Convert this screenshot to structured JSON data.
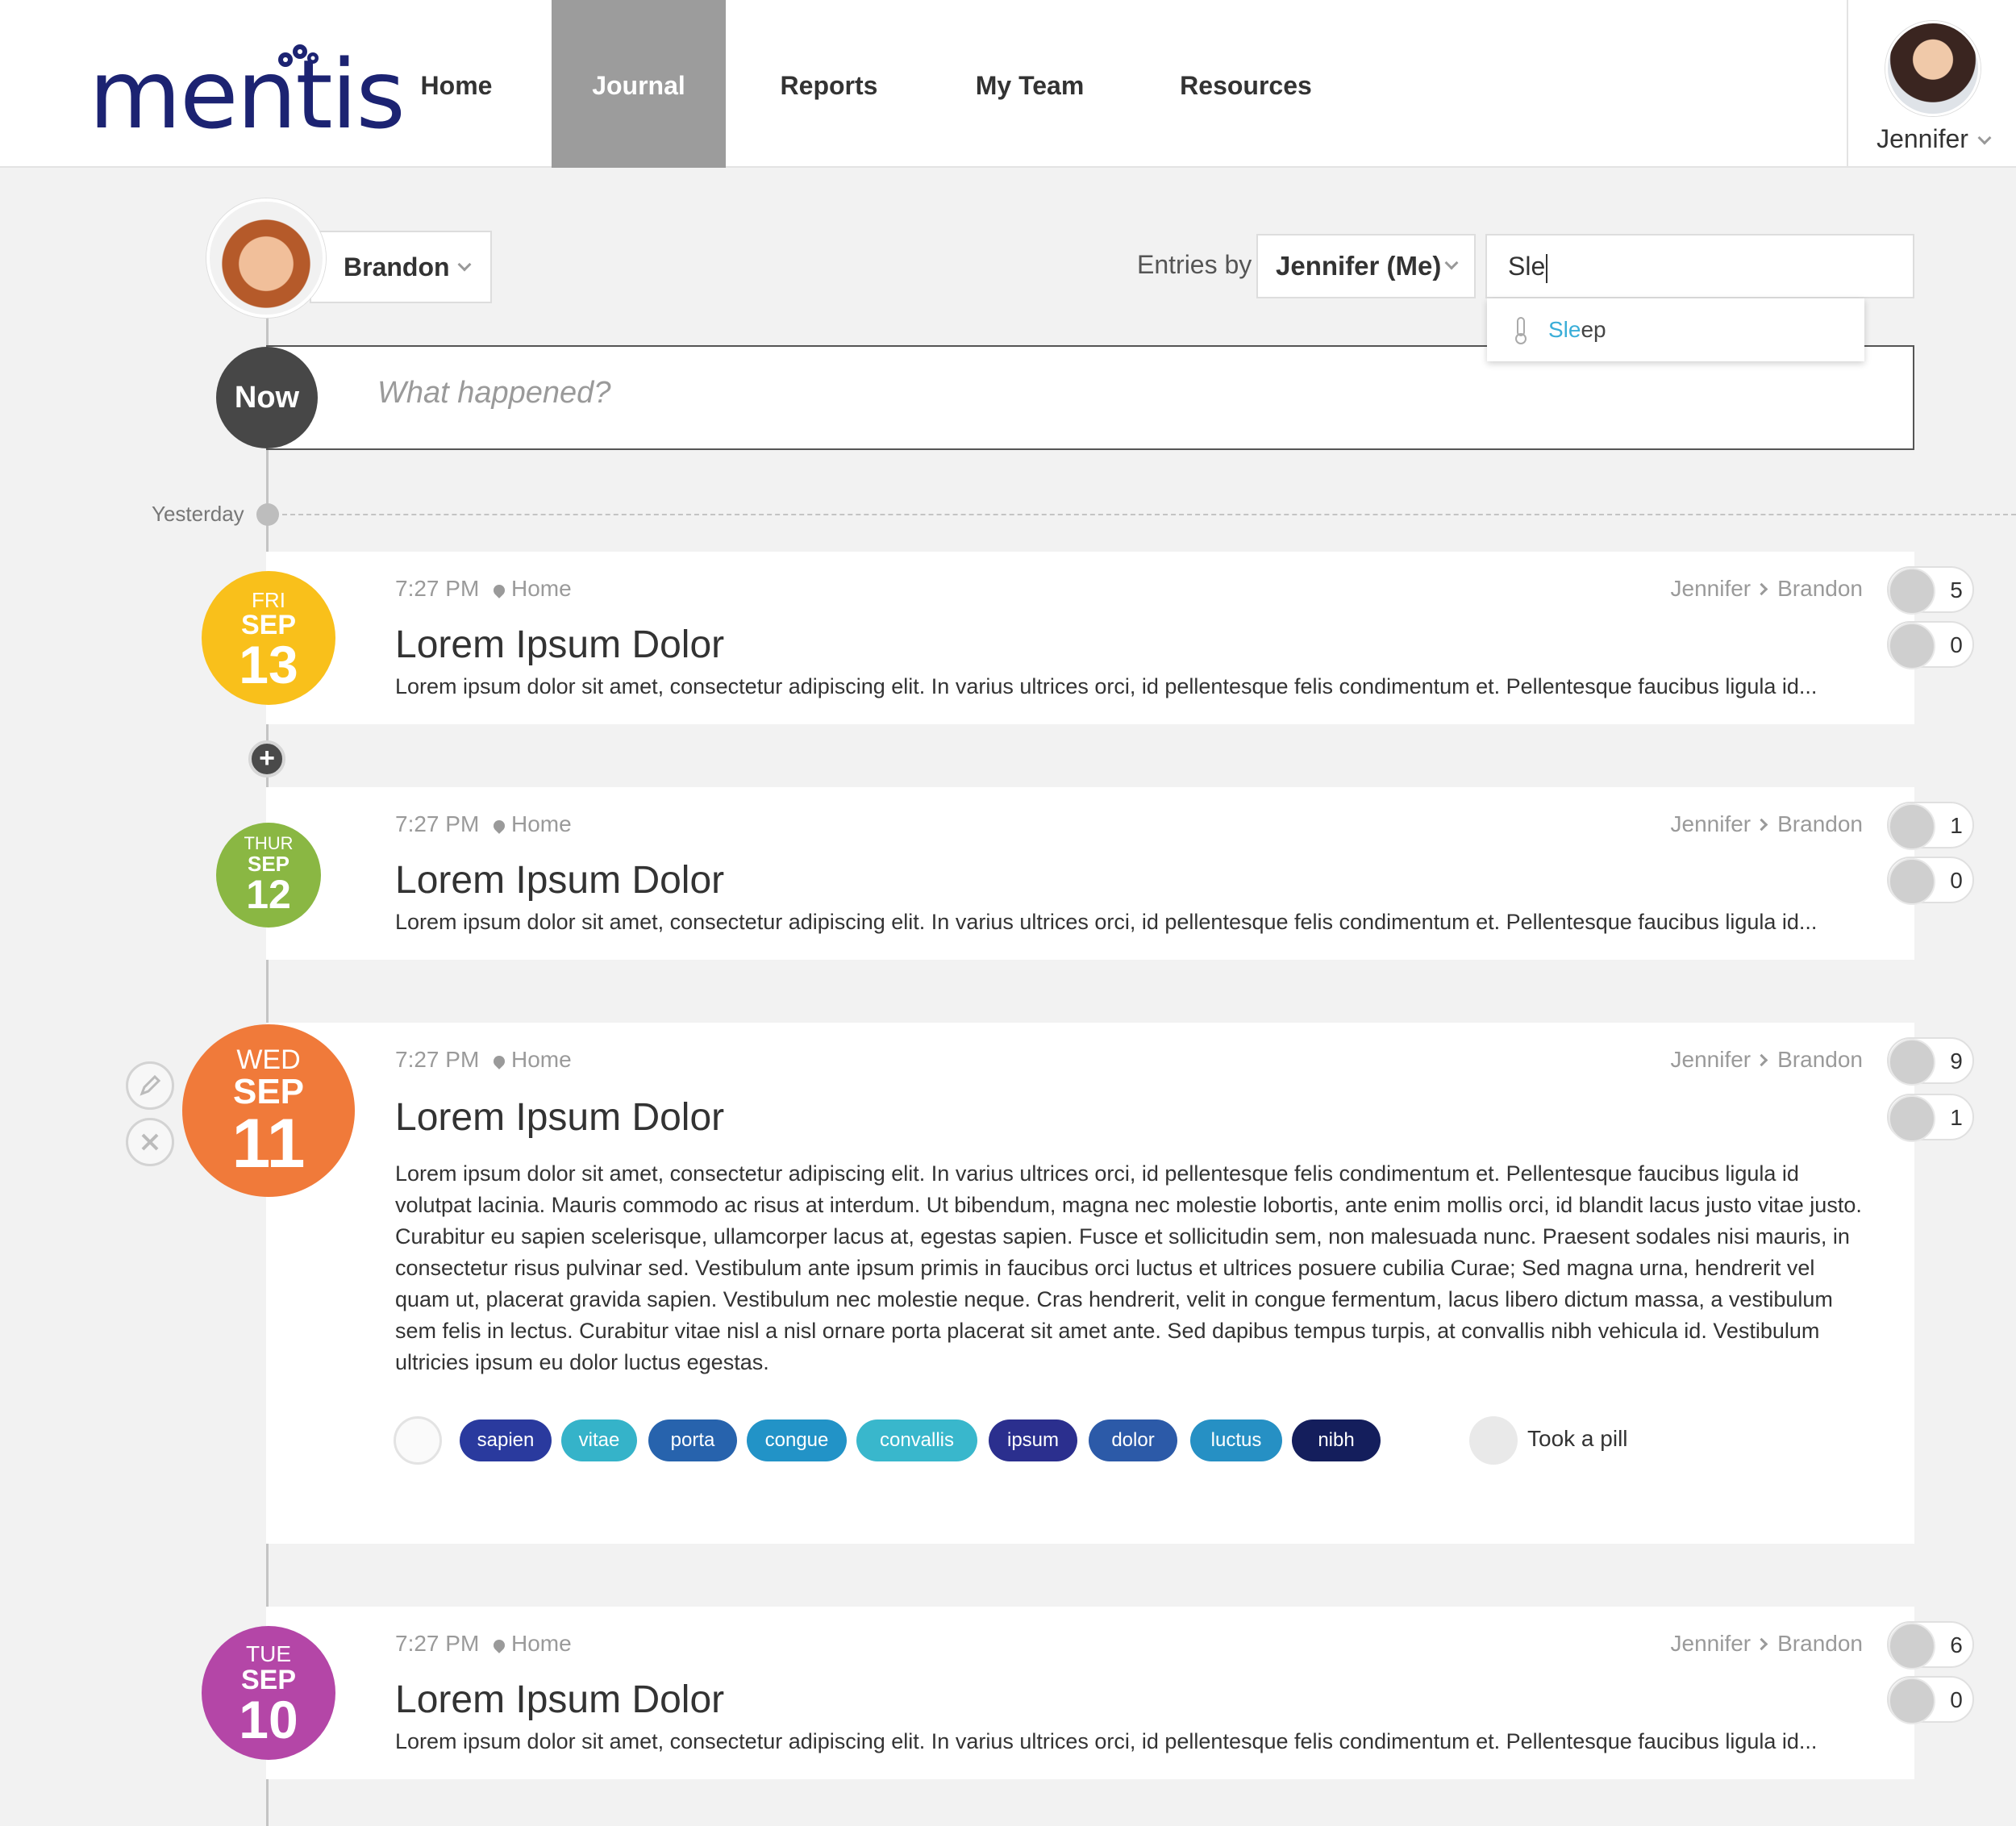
{
  "brand": {
    "logo_text": "mentis"
  },
  "nav": {
    "items": [
      {
        "label": "Home"
      },
      {
        "label": "Journal",
        "active": true
      },
      {
        "label": "Reports"
      },
      {
        "label": "My Team"
      },
      {
        "label": "Resources"
      }
    ]
  },
  "user": {
    "name": "Jennifer"
  },
  "child": {
    "name": "Brandon"
  },
  "filters": {
    "entries_by_label": "Entries by",
    "entries_by_value": "Jennifer (Me)",
    "search_value": "Sle",
    "suggestion": {
      "match": "Sle",
      "rest": "ep",
      "icon": "thermometer-icon"
    }
  },
  "composer": {
    "now_label": "Now",
    "placeholder": "What happened?"
  },
  "timeline": {
    "yesterday_label": "Yesterday"
  },
  "entries": [
    {
      "dow": "FRI",
      "month": "SEP",
      "day": "13",
      "color": "#f9c01b",
      "time": "7:27 PM",
      "location": "Home",
      "from": "Jennifer",
      "to": "Brandon",
      "title": "Lorem Ipsum Dolor",
      "text": "Lorem ipsum dolor sit amet, consectetur adipiscing elit. In varius ultrices orci, id pellentesque felis condimentum et. Pellentesque faucibus ligula id...",
      "count_a": "5",
      "count_b": "0"
    },
    {
      "dow": "THUR",
      "month": "SEP",
      "day": "12",
      "color": "#8ab743",
      "time": "7:27 PM",
      "location": "Home",
      "from": "Jennifer",
      "to": "Brandon",
      "title": "Lorem Ipsum Dolor",
      "text": "Lorem ipsum dolor sit amet, consectetur adipiscing elit. In varius ultrices orci, id pellentesque felis condimentum et. Pellentesque faucibus ligula id...",
      "count_a": "1",
      "count_b": "0"
    },
    {
      "dow": "WED",
      "month": "SEP",
      "day": "11",
      "color": "#f07a3a",
      "time": "7:27 PM",
      "location": "Home",
      "from": "Jennifer",
      "to": "Brandon",
      "title": "Lorem Ipsum Dolor",
      "text": "Lorem ipsum dolor sit amet, consectetur adipiscing elit. In varius ultrices orci, id pellentesque felis condimentum et. Pellentesque faucibus ligula id volutpat lacinia. Mauris commodo ac risus at interdum. Ut bibendum, magna nec molestie lobortis, ante enim mollis orci, id blandit lacus justo vitae justo. Curabitur eu sapien scelerisque, ullamcorper lacus at, egestas sapien. Fusce et sollicitudin sem, non malesuada nunc. Praesent sodales nisi mauris, in consectetur risus pulvinar sed. Vestibulum ante ipsum primis in faucibus orci luctus et ultrices posuere cubilia Curae; Sed magna urna, hendrerit vel quam ut, placerat gravida sapien. Vestibulum nec molestie neque. Cras hendrerit, velit in congue fermentum, lacus libero dictum massa, a vestibulum sem felis in lectus. Curabitur vitae nisl a nisl ornare porta placerat sit amet ante. Sed dapibus tempus turpis, at convallis nibh vehicula id. Vestibulum ultricies ipsum eu dolor luctus egestas.",
      "count_a": "9",
      "count_b": "1",
      "tags": [
        {
          "label": "sapien",
          "color": "#2a3a9e"
        },
        {
          "label": "vitae",
          "color": "#35b3c9"
        },
        {
          "label": "porta",
          "color": "#2763ad"
        },
        {
          "label": "congue",
          "color": "#2293c7"
        },
        {
          "label": "convallis",
          "color": "#39b7cc"
        },
        {
          "label": "ipsum",
          "color": "#2b2f8e"
        },
        {
          "label": "dolor",
          "color": "#2c5aa8"
        },
        {
          "label": "luctus",
          "color": "#2690c4"
        },
        {
          "label": "nibh",
          "color": "#141e5c"
        }
      ],
      "action_label": "Took a pill"
    },
    {
      "dow": "TUE",
      "month": "SEP",
      "day": "10",
      "color": "#b446a7",
      "time": "7:27 PM",
      "location": "Home",
      "from": "Jennifer",
      "to": "Brandon",
      "title": "Lorem Ipsum Dolor",
      "text": "Lorem ipsum dolor sit amet, consectetur adipiscing elit. In varius ultrices orci, id pellentesque felis condimentum et. Pellentesque faucibus ligula id...",
      "count_a": "6",
      "count_b": "0"
    }
  ]
}
